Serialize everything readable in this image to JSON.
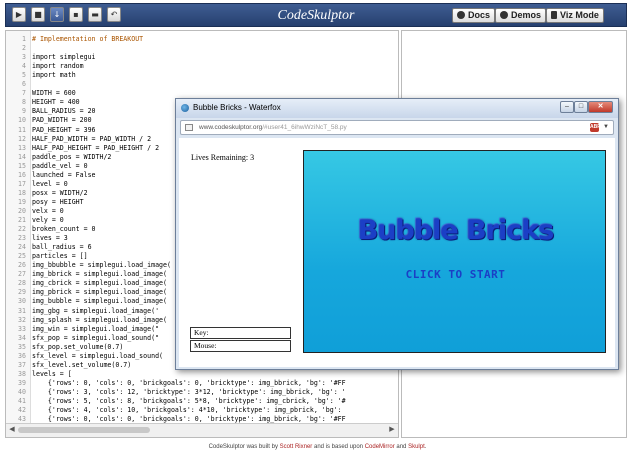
{
  "app": {
    "title": "CodeSkulptor"
  },
  "toolbar": {
    "icons": [
      "run-icon",
      "save-icon",
      "download-icon",
      "new-icon",
      "open-icon",
      "reset-icon"
    ],
    "docs_label": "Docs",
    "demos_label": "Demos",
    "vizmode_label": "Viz Mode"
  },
  "editor": {
    "lines": [
      "# Implementation of BREAKOUT",
      "",
      "import simplegui",
      "import random",
      "import math",
      "",
      "WIDTH = 600",
      "HEIGHT = 400",
      "BALL_RADIUS = 20",
      "PAD_WIDTH = 200",
      "PAD_HEIGHT = 396",
      "HALF_PAD_WIDTH = PAD_WIDTH / 2",
      "HALF_PAD_HEIGHT = PAD_HEIGHT / 2",
      "paddle_pos = WIDTH/2",
      "paddle_vel = 0",
      "launched = False",
      "level = 0",
      "posx = WIDTH/2",
      "posy = HEIGHT",
      "velx = 0",
      "vely = 0",
      "broken_count = 0",
      "lives = 3",
      "ball_radius = 6",
      "particles = []",
      "img_bbubble = simplegui.load_image(",
      "img_bbrick = simplegui.load_image(",
      "img_cbrick = simplegui.load_image(",
      "img_pbrick = simplegui.load_image(",
      "img_bubble = simplegui.load_image(",
      "img_gbg = simplegui.load_image('",
      "img_splash = simplegui.load_image(",
      "img_win = simplegui.load_image(\"",
      "sfx_pop = simplegui.load_sound(\"",
      "sfx_pop.set_volume(0.7)",
      "sfx_level = simplegui.load_sound(",
      "sfx_level.set_volume(0.7)",
      "levels = [",
      "    {'rows': 0, 'cols': 0, 'brickgoals': 0, 'bricktype': img_bbrick, 'bg': '#FF",
      "    {'rows': 3, 'cols': 12, 'bricktype': 3*12, 'bricktype': img_bbrick, 'bg': '",
      "    {'rows': 5, 'cols': 8, 'brickgoals': 5*8, 'bricktype': img_cbrick, 'bg': '#",
      "    {'rows': 4, 'cols': 10, 'brickgoals': 4*10, 'bricktype': img_pbrick, 'bg': ",
      "    {'rows': 0, 'cols': 0, 'brickgoals': 0, 'bricktype': img_bbrick, 'bg': '#FF",
      "]"
    ]
  },
  "popup": {
    "window_title": "Bubble Bricks - Waterfox",
    "url_domain": "www.codeskulptor.org",
    "url_path": "/#user41_6ihwWziNcT_58.py",
    "addon_badge": "ABP",
    "lives_label": "Lives Remaining: 3",
    "key_label": "Key:",
    "mouse_label": "Mouse:",
    "game_title": "Bubble Bricks",
    "click_to_start": "CLICK TO START",
    "winbtn_min": "–",
    "winbtn_max": "□",
    "winbtn_close": "✕"
  },
  "footer": {
    "prefix": "CodeSkulptor was built by ",
    "author": "Scott Rixner",
    "middle": " and is based upon ",
    "lib1": "CodeMirror",
    "and": " and ",
    "lib2": "Skulpt",
    "end": "."
  },
  "colors": {
    "toolbar": "#2e4a80",
    "canvas_bg": "#16a7dc",
    "game_text": "#1b3fc6"
  }
}
